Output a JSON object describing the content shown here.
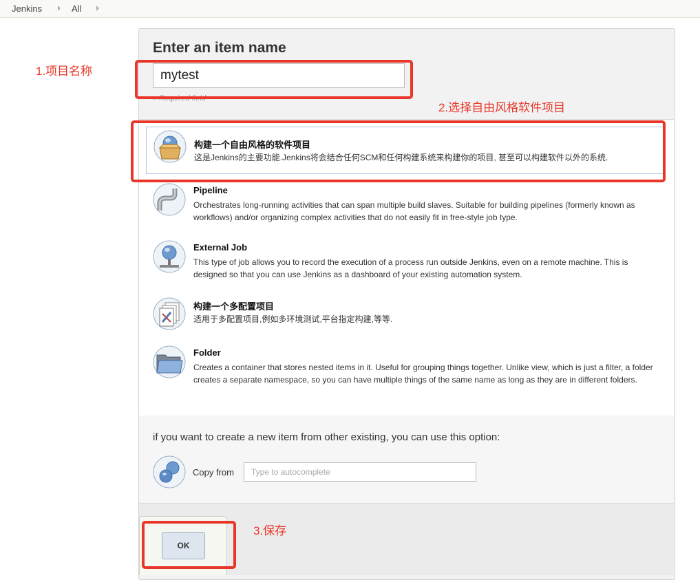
{
  "breadcrumbs": [
    "Jenkins",
    "All"
  ],
  "form": {
    "title": "Enter an item name",
    "name_value": "mytest",
    "required_hint": "» Required field"
  },
  "item_types": [
    {
      "name": "构建一个自由风格的软件项目",
      "description": "这是Jenkins的主要功能.Jenkins将会结合任何SCM和任何构建系统来构建你的项目, 甚至可以构建软件以外的系统.",
      "icon": "freestyle-box-icon",
      "selected": true
    },
    {
      "name": "Pipeline",
      "description": "Orchestrates long-running activities that can span multiple build slaves. Suitable for building pipelines (formerly known as workflows) and/or organizing complex activities that do not easily fit in free-style job type.",
      "icon": "pipe-icon",
      "selected": false
    },
    {
      "name": "External Job",
      "description": "This type of job allows you to record the execution of a process run outside Jenkins, even on a remote machine. This is designed so that you can use Jenkins as a dashboard of your existing automation system.",
      "icon": "network-globe-icon",
      "selected": false
    },
    {
      "name": "构建一个多配置项目",
      "description": "适用于多配置项目,例如多环境测试,平台指定构建,等等.",
      "icon": "multi-config-icon",
      "selected": false
    },
    {
      "name": "Folder",
      "description": "Creates a container that stores nested items in it. Useful for grouping things together. Unlike view, which is just a filter, a folder creates a separate namespace, so you can have multiple things of the same name as long as they are in different folders.",
      "icon": "folder-icon",
      "selected": false
    }
  ],
  "copy": {
    "title": "if you want to create a new item from other existing, you can use this option:",
    "label": "Copy from",
    "placeholder": "Type to autocomplete",
    "icon": "copy-globes-icon"
  },
  "ok_label": "OK",
  "annotations": {
    "step1": "1.项目名称",
    "step2": "2.选择自由风格软件项目",
    "step3": "3.保存",
    "color": "#e8362a"
  }
}
